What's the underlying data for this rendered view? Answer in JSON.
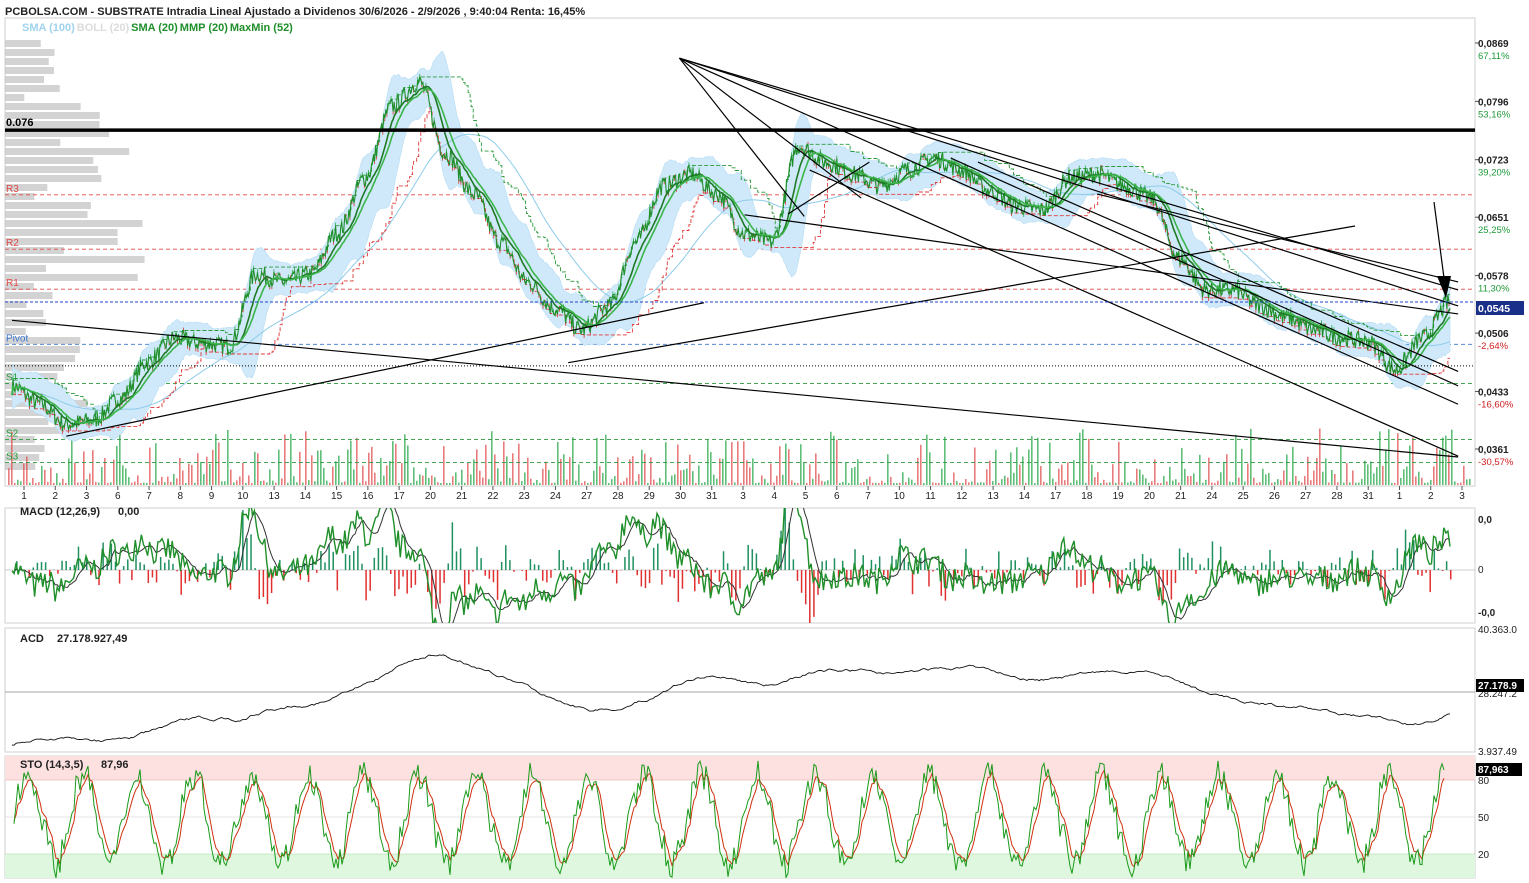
{
  "header": {
    "title": "PCBOLSA.COM - SUBSTRATE Intradia Lineal Ajustado a Dividenos 30/6/2026 - 2/9/2026 , 9:40:04 Renta: 16,45%"
  },
  "legend": [
    {
      "label": "SMA (100)",
      "color": "#9fd3ee"
    },
    {
      "label": "BOLL (20)",
      "color": "#dcdcdc"
    },
    {
      "label": "SMA (20)",
      "color": "#1f8f2a"
    },
    {
      "label": "MMP (20)",
      "color": "#1f8f2a"
    },
    {
      "label": "MaxMin (52)",
      "color": "#1f8f2a"
    }
  ],
  "colors": {
    "price": "#1f8f2a",
    "price_up": "#2aa84a",
    "price_down": "#d83030",
    "bollinger_fill": "#cfe9fa",
    "sma100": "#9fd3ee",
    "maxmin_up": "#2a9a3a",
    "maxmin_down": "#e03a3a",
    "pivot_blue": "#2244cc",
    "macd_pos": "#1f9060",
    "macd_neg": "#e03030",
    "sto_fast": "#1a9a1a",
    "sto_slow": "#d03010"
  },
  "chart_data": [
    {
      "type": "line",
      "name": "main-price",
      "y_ticks": [
        {
          "value": "0,0869",
          "pct": "67,11%"
        },
        {
          "value": "0,0796",
          "pct": "53,16%"
        },
        {
          "value": "0,0723",
          "pct": "39,20%"
        },
        {
          "value": "0,0651",
          "pct": "25,25%"
        },
        {
          "value": "0,0578",
          "pct": "11,30%"
        },
        {
          "value": "0,0506",
          "pct": "-2,64%"
        },
        {
          "value": "0,0433",
          "pct": "-16,60%"
        },
        {
          "value": "0,0361",
          "pct": "-30,57%"
        }
      ],
      "current_price": "0,0545",
      "ylim": [
        0.0338,
        0.0894
      ],
      "horizontal_line": {
        "label": "0.076",
        "value": 0.076
      },
      "levels": [
        {
          "label": "R3",
          "value": 0.0679,
          "color": "#e04848"
        },
        {
          "label": "R2",
          "value": 0.0611,
          "color": "#e04848"
        },
        {
          "label": "R1",
          "value": 0.0561,
          "color": "#e04848"
        },
        {
          "label": "Pivot",
          "value": 0.0492,
          "color": "#3a78d0"
        },
        {
          "label": "S1",
          "value": 0.0443,
          "color": "#2a9a3a"
        },
        {
          "label": "S2",
          "value": 0.0373,
          "color": "#2a9a3a"
        },
        {
          "label": "S3",
          "value": 0.0344,
          "color": "#2a9a3a"
        }
      ],
      "x_ticks": [
        "1",
        "2",
        "3",
        "6",
        "7",
        "8",
        "9",
        "10",
        "13",
        "14",
        "15",
        "16",
        "17",
        "20",
        "21",
        "22",
        "23",
        "24",
        "27",
        "28",
        "29",
        "30",
        "31",
        "3",
        "4",
        "5",
        "6",
        "7",
        "10",
        "11",
        "12",
        "13",
        "14",
        "17",
        "18",
        "19",
        "20",
        "21",
        "24",
        "25",
        "26",
        "27",
        "28",
        "31",
        "1",
        "2",
        "3"
      ],
      "close_points": [
        [
          0,
          0.044
        ],
        [
          1,
          0.0418
        ],
        [
          2,
          0.0392
        ],
        [
          3,
          0.0397
        ],
        [
          4,
          0.0425
        ],
        [
          5,
          0.047
        ],
        [
          6,
          0.05
        ],
        [
          7,
          0.0493
        ],
        [
          8,
          0.049
        ],
        [
          9,
          0.058
        ],
        [
          10,
          0.057
        ],
        [
          11,
          0.058
        ],
        [
          12,
          0.0632
        ],
        [
          13,
          0.07
        ],
        [
          14,
          0.079
        ],
        [
          15,
          0.082
        ],
        [
          16,
          0.073
        ],
        [
          17,
          0.068
        ],
        [
          18,
          0.062
        ],
        [
          19,
          0.057
        ],
        [
          20,
          0.0537
        ],
        [
          21,
          0.051
        ],
        [
          22,
          0.054
        ],
        [
          23,
          0.062
        ],
        [
          24,
          0.069
        ],
        [
          25,
          0.0705
        ],
        [
          26,
          0.068
        ],
        [
          27,
          0.063
        ],
        [
          28,
          0.062
        ],
        [
          29,
          0.074
        ],
        [
          30,
          0.072
        ],
        [
          31,
          0.0705
        ],
        [
          32,
          0.069
        ],
        [
          33,
          0.071
        ],
        [
          34,
          0.0725
        ],
        [
          35,
          0.071
        ],
        [
          36,
          0.0685
        ],
        [
          37,
          0.0665
        ],
        [
          38,
          0.066
        ],
        [
          39,
          0.07
        ],
        [
          40,
          0.0705
        ],
        [
          41,
          0.069
        ],
        [
          42,
          0.0675
        ],
        [
          43,
          0.06
        ],
        [
          44,
          0.056
        ],
        [
          45,
          0.056
        ],
        [
          46,
          0.054
        ],
        [
          47,
          0.0525
        ],
        [
          48,
          0.051
        ],
        [
          49,
          0.05
        ],
        [
          50,
          0.0495
        ],
        [
          51,
          0.046
        ],
        [
          52,
          0.05
        ],
        [
          53,
          0.0545
        ]
      ]
    },
    {
      "type": "line",
      "name": "macd",
      "title": "MACD (12,26,9)",
      "value": "0,00",
      "y_ticks": [
        "0,0",
        "0",
        "-0,0"
      ]
    },
    {
      "type": "line",
      "name": "acd",
      "title": "ACD",
      "value": "27.178.927,49",
      "y_ticks": [
        "40.363.0",
        "28.247.2",
        "3.937.49"
      ],
      "current": "27.178.9"
    },
    {
      "type": "line",
      "name": "sto",
      "title": "STO (14,3,5)",
      "value": "87,96",
      "y_ticks": [
        "80",
        "50",
        "20"
      ],
      "current": "87,963"
    }
  ]
}
